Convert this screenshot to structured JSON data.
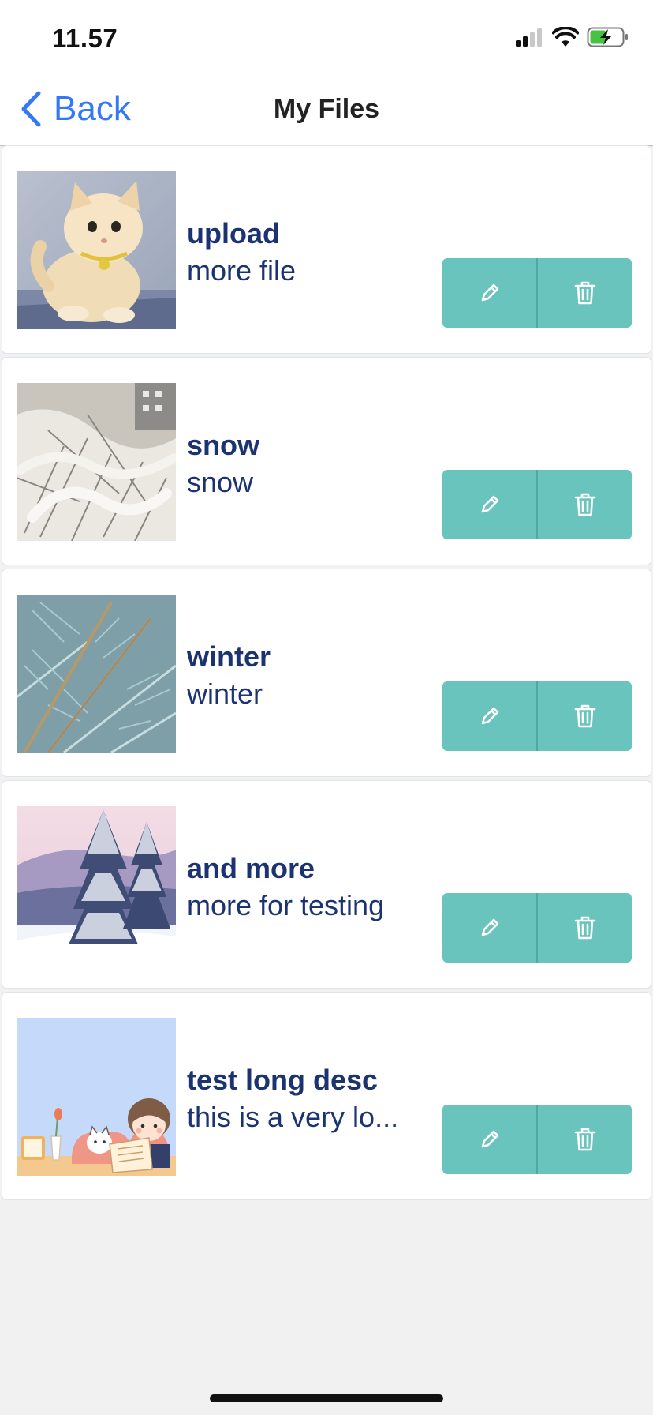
{
  "status_bar": {
    "time": "11.57",
    "icons": [
      "cellular-signal-icon",
      "wifi-icon",
      "battery-charging-icon"
    ]
  },
  "nav": {
    "back_label": "Back",
    "title": "My Files"
  },
  "accent_colors": {
    "back_link": "#3478f6",
    "action_buttons": "#69c4bd",
    "item_text": "#1c3372"
  },
  "files": [
    {
      "title": "upload",
      "description": "more file",
      "thumbnail": "kitten-photo"
    },
    {
      "title": "snow",
      "description": "snow",
      "thumbnail": "snowy-branches-photo"
    },
    {
      "title": "winter",
      "description": "winter",
      "thumbnail": "spruce-branches-photo"
    },
    {
      "title": "and more",
      "description": "more for testing",
      "thumbnail": "snowy-pines-landscape-photo"
    },
    {
      "title": "test long desc",
      "description": "this is a very lo...",
      "thumbnail": "reading-girl-illustration"
    }
  ]
}
